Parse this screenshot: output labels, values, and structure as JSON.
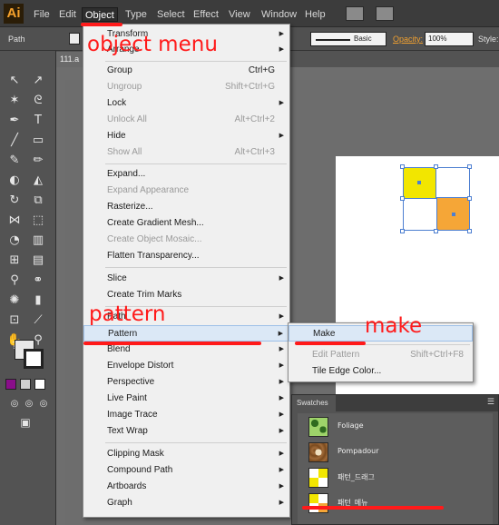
{
  "app": {
    "logo": "Ai",
    "menus": [
      "File",
      "Edit",
      "Object",
      "Type",
      "Select",
      "Effect",
      "View",
      "Window",
      "Help"
    ],
    "active_menu": "Object"
  },
  "control_bar": {
    "selection_label": "Path",
    "stroke_style": "Basic",
    "opacity_label": "Opacity:",
    "opacity_value": "100%",
    "style_label": "Style:"
  },
  "document": {
    "tab_title": "111.a"
  },
  "object_menu": {
    "items": [
      {
        "label": "Transform",
        "shortcut": "",
        "submenu": true,
        "disabled": false
      },
      {
        "label": "Arrange",
        "shortcut": "",
        "submenu": true,
        "disabled": false
      },
      {
        "label": "Group",
        "shortcut": "Ctrl+G",
        "submenu": false,
        "disabled": false
      },
      {
        "label": "Ungroup",
        "shortcut": "Shift+Ctrl+G",
        "submenu": false,
        "disabled": true
      },
      {
        "label": "Lock",
        "shortcut": "",
        "submenu": true,
        "disabled": false
      },
      {
        "label": "Unlock All",
        "shortcut": "Alt+Ctrl+2",
        "submenu": false,
        "disabled": true
      },
      {
        "label": "Hide",
        "shortcut": "",
        "submenu": true,
        "disabled": false
      },
      {
        "label": "Show All",
        "shortcut": "Alt+Ctrl+3",
        "submenu": false,
        "disabled": true
      },
      {
        "label": "Expand...",
        "shortcut": "",
        "submenu": false,
        "disabled": false
      },
      {
        "label": "Expand Appearance",
        "shortcut": "",
        "submenu": false,
        "disabled": true
      },
      {
        "label": "Rasterize...",
        "shortcut": "",
        "submenu": false,
        "disabled": false
      },
      {
        "label": "Create Gradient Mesh...",
        "shortcut": "",
        "submenu": false,
        "disabled": false
      },
      {
        "label": "Create Object Mosaic...",
        "shortcut": "",
        "submenu": false,
        "disabled": true
      },
      {
        "label": "Flatten Transparency...",
        "shortcut": "",
        "submenu": false,
        "disabled": false
      },
      {
        "label": "Slice",
        "shortcut": "",
        "submenu": true,
        "disabled": false
      },
      {
        "label": "Create Trim Marks",
        "shortcut": "",
        "submenu": false,
        "disabled": false
      },
      {
        "label": "Path",
        "shortcut": "",
        "submenu": true,
        "disabled": false
      },
      {
        "label": "Pattern",
        "shortcut": "",
        "submenu": true,
        "disabled": false,
        "highlighted": true
      },
      {
        "label": "Blend",
        "shortcut": "",
        "submenu": true,
        "disabled": false
      },
      {
        "label": "Envelope Distort",
        "shortcut": "",
        "submenu": true,
        "disabled": false
      },
      {
        "label": "Perspective",
        "shortcut": "",
        "submenu": true,
        "disabled": false
      },
      {
        "label": "Live Paint",
        "shortcut": "",
        "submenu": true,
        "disabled": false
      },
      {
        "label": "Image Trace",
        "shortcut": "",
        "submenu": true,
        "disabled": false
      },
      {
        "label": "Text Wrap",
        "shortcut": "",
        "submenu": true,
        "disabled": false
      },
      {
        "label": "Clipping Mask",
        "shortcut": "",
        "submenu": true,
        "disabled": false
      },
      {
        "label": "Compound Path",
        "shortcut": "",
        "submenu": true,
        "disabled": false
      },
      {
        "label": "Artboards",
        "shortcut": "",
        "submenu": true,
        "disabled": false
      },
      {
        "label": "Graph",
        "shortcut": "",
        "submenu": true,
        "disabled": false
      }
    ]
  },
  "pattern_submenu": {
    "items": [
      {
        "label": "Make",
        "shortcut": "",
        "disabled": false,
        "highlighted": true
      },
      {
        "label": "Edit Pattern",
        "shortcut": "Shift+Ctrl+F8",
        "disabled": true
      },
      {
        "label": "Tile Edge Color...",
        "shortcut": "",
        "disabled": false
      }
    ]
  },
  "swatches_panel": {
    "title": "Swatches",
    "items": [
      {
        "name": "Foliage",
        "thumb": "foliage"
      },
      {
        "name": "Pompadour",
        "thumb": "pompadour"
      },
      {
        "name": "패턴_드래그",
        "thumb": "yellow-checker"
      },
      {
        "name": "패턴_메뉴",
        "thumb": "yellow-checker"
      }
    ]
  },
  "annotations": {
    "object_menu": "object menu",
    "pattern": "pattern",
    "make": "make"
  },
  "colors": {
    "annotation_red": "#ff1a1a",
    "yellow": "#f2e600",
    "orange": "#f5a637",
    "selection_blue": "#4d7fd1",
    "menu_bg": "#f0f0f0",
    "highlight": "#dbe8f6"
  }
}
